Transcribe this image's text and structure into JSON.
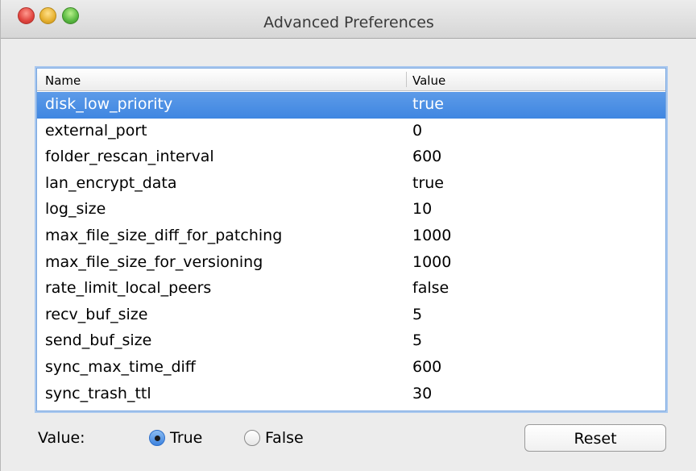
{
  "window": {
    "title": "Advanced Preferences"
  },
  "table": {
    "columns": [
      "Name",
      "Value"
    ],
    "rows": [
      {
        "name": "disk_low_priority",
        "value": "true",
        "selected": true
      },
      {
        "name": "external_port",
        "value": "0",
        "selected": false
      },
      {
        "name": "folder_rescan_interval",
        "value": "600",
        "selected": false
      },
      {
        "name": "lan_encrypt_data",
        "value": "true",
        "selected": false
      },
      {
        "name": "log_size",
        "value": "10",
        "selected": false
      },
      {
        "name": "max_file_size_diff_for_patching",
        "value": "1000",
        "selected": false
      },
      {
        "name": "max_file_size_for_versioning",
        "value": "1000",
        "selected": false
      },
      {
        "name": "rate_limit_local_peers",
        "value": "false",
        "selected": false
      },
      {
        "name": "recv_buf_size",
        "value": "5",
        "selected": false
      },
      {
        "name": "send_buf_size",
        "value": "5",
        "selected": false
      },
      {
        "name": "sync_max_time_diff",
        "value": "600",
        "selected": false
      },
      {
        "name": "sync_trash_ttl",
        "value": "30",
        "selected": false
      }
    ]
  },
  "footer": {
    "value_label": "Value:",
    "options": [
      {
        "label": "True",
        "checked": true
      },
      {
        "label": "False",
        "checked": false
      }
    ],
    "reset_label": "Reset"
  },
  "colors": {
    "selection": "#3f86e1",
    "focus_ring": "#7aa7df",
    "window_bg": "#ececec"
  }
}
